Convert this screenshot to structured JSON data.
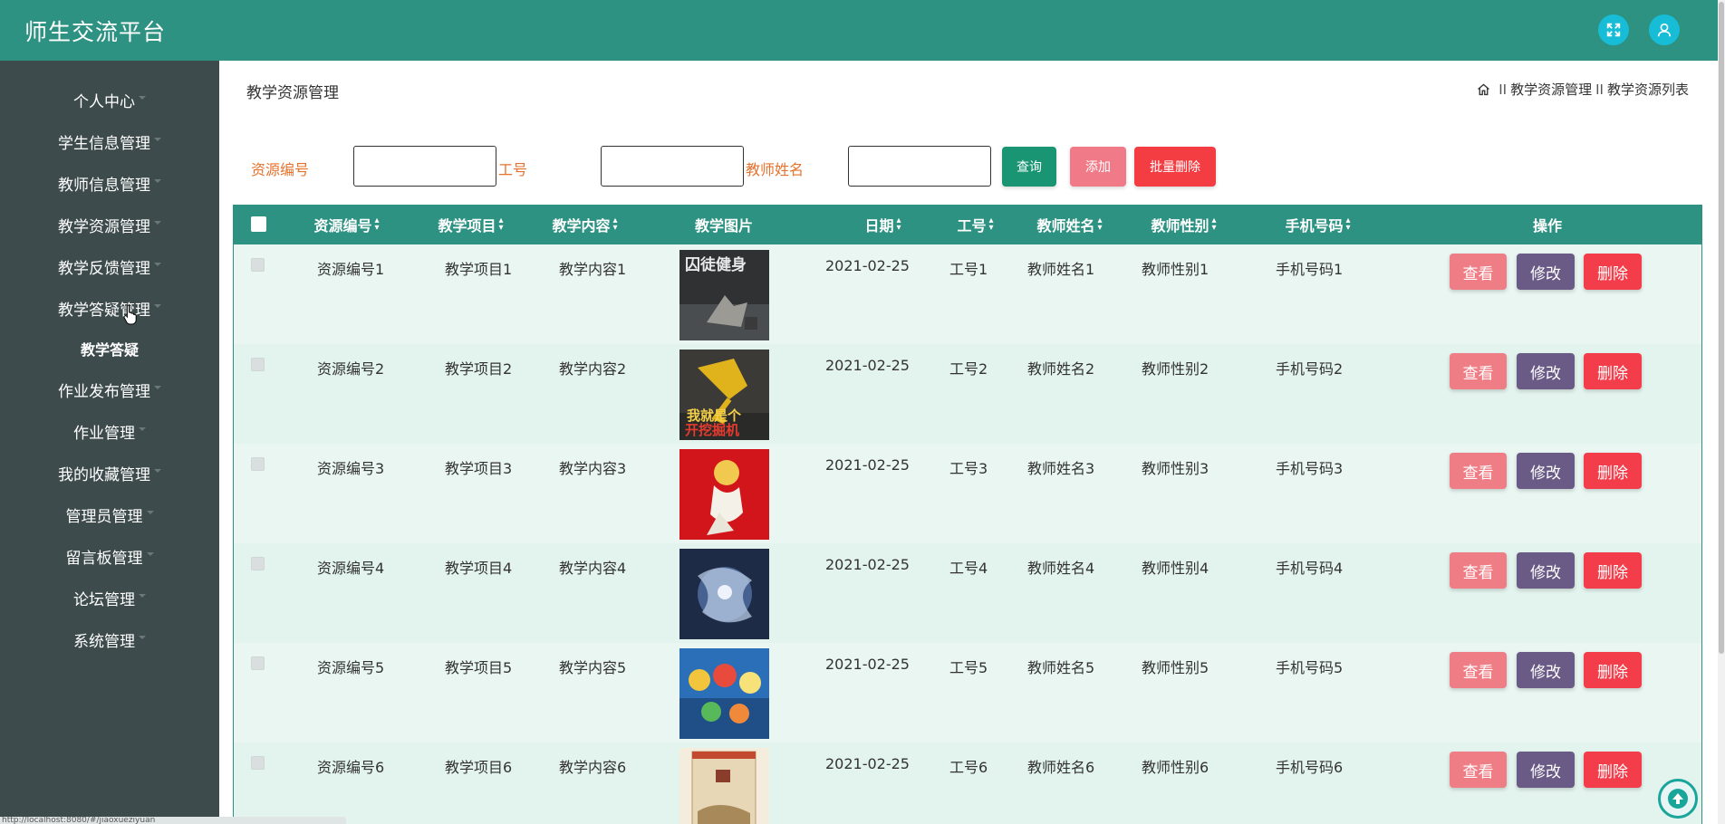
{
  "header": {
    "app_title": "师生交流平台",
    "brand_color": "#2e9282",
    "icons": [
      "fullscreen-icon",
      "user-icon"
    ]
  },
  "sidebar": {
    "items": [
      {
        "label": "个人中心"
      },
      {
        "label": "学生信息管理"
      },
      {
        "label": "教师信息管理"
      },
      {
        "label": "教学资源管理"
      },
      {
        "label": "教学反馈管理"
      },
      {
        "label": "教学答疑管理"
      },
      {
        "label": "教学答疑"
      },
      {
        "label": "作业发布管理"
      },
      {
        "label": "作业管理"
      },
      {
        "label": "我的收藏管理"
      },
      {
        "label": "管理员管理"
      },
      {
        "label": "留言板管理"
      },
      {
        "label": "论坛管理"
      },
      {
        "label": "系统管理"
      }
    ]
  },
  "page": {
    "title": "教学资源管理",
    "breadcrumb": [
      "教学资源管理",
      "教学资源列表"
    ],
    "breadcrumb_sep": "II"
  },
  "search": {
    "resource_id_label": "资源编号",
    "staff_id_label": "工号",
    "teacher_name_label": "教师姓名",
    "resource_id_value": "",
    "staff_id_value": "",
    "teacher_name_value": ""
  },
  "buttons": {
    "query": "查询",
    "add": "添加",
    "batch_delete": "批量删除"
  },
  "table": {
    "columns": [
      "资源编号",
      "教学项目",
      "教学内容",
      "教学图片",
      "日期",
      "工号",
      "教师姓名",
      "教师性别",
      "手机号码",
      "操作"
    ],
    "rows": [
      {
        "resource_id": "资源编号1",
        "project": "教学项目1",
        "content": "教学内容1",
        "date": "2021-02-25",
        "staff_id": "工号1",
        "teacher_name": "教师姓名1",
        "gender": "教师性别1",
        "phone": "手机号码1"
      },
      {
        "resource_id": "资源编号2",
        "project": "教学项目2",
        "content": "教学内容2",
        "date": "2021-02-25",
        "staff_id": "工号2",
        "teacher_name": "教师姓名2",
        "gender": "教师性别2",
        "phone": "手机号码2"
      },
      {
        "resource_id": "资源编号3",
        "project": "教学项目3",
        "content": "教学内容3",
        "date": "2021-02-25",
        "staff_id": "工号3",
        "teacher_name": "教师姓名3",
        "gender": "教师性别3",
        "phone": "手机号码3"
      },
      {
        "resource_id": "资源编号4",
        "project": "教学项目4",
        "content": "教学内容4",
        "date": "2021-02-25",
        "staff_id": "工号4",
        "teacher_name": "教师姓名4",
        "gender": "教师性别4",
        "phone": "手机号码4"
      },
      {
        "resource_id": "资源编号5",
        "project": "教学项目5",
        "content": "教学内容5",
        "date": "2021-02-25",
        "staff_id": "工号5",
        "teacher_name": "教师姓名5",
        "gender": "教师性别5",
        "phone": "手机号码5"
      },
      {
        "resource_id": "资源编号6",
        "project": "教学项目6",
        "content": "教学内容6",
        "date": "2021-02-25",
        "staff_id": "工号6",
        "teacher_name": "教师姓名6",
        "gender": "教师性别6",
        "phone": "手机号码6"
      }
    ],
    "actions": {
      "view": "查看",
      "edit": "修改",
      "delete": "删除"
    }
  },
  "status_bar": {
    "text": "http://localhost:8080/#/jiaoxueziyuan"
  }
}
